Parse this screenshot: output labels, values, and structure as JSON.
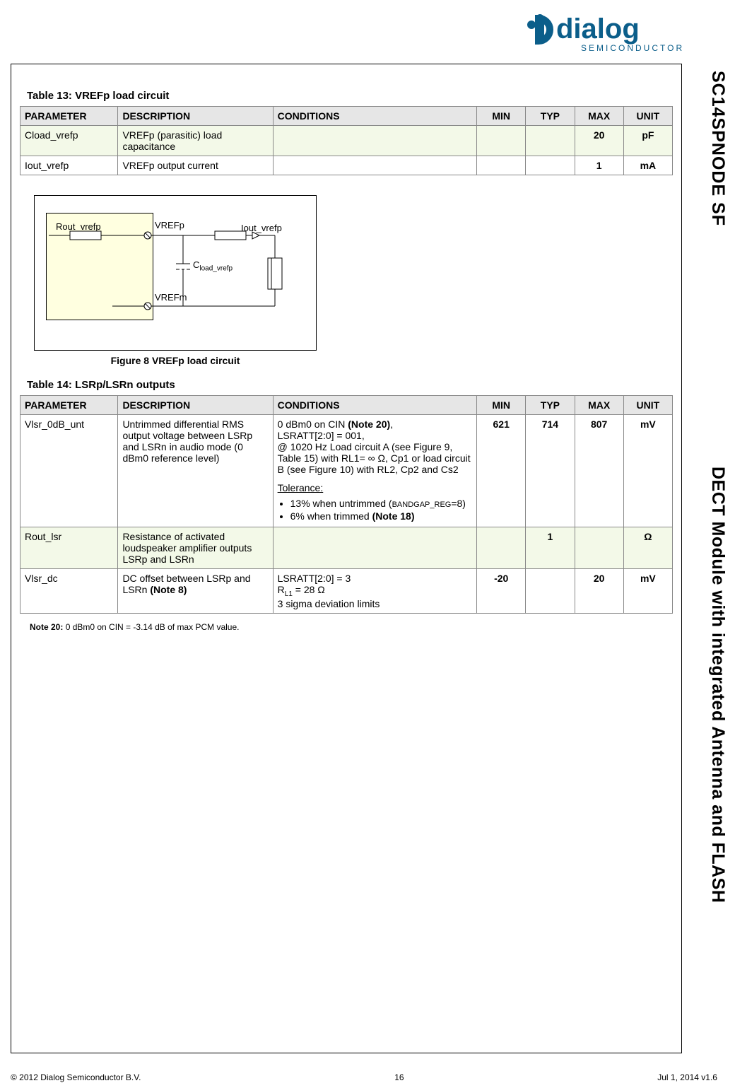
{
  "header": {
    "logo_main": "dialog",
    "logo_sub": "SEMICONDUCTOR"
  },
  "side": {
    "top": "SC14SPNODE SF",
    "bottom": "DECT Module with integrated Antenna and FLASH"
  },
  "table13": {
    "title": "Table 13: VREFp load circuit",
    "headers": [
      "PARAMETER",
      "DESCRIPTION",
      "CONDITIONS",
      "MIN",
      "TYP",
      "MAX",
      "UNIT"
    ],
    "rows": [
      {
        "param": "Cload_vrefp",
        "desc": "VREFp (parasitic) load capacitance",
        "cond": "",
        "min": "",
        "typ": "",
        "max": "20",
        "unit": "pF"
      },
      {
        "param": "Iout_vrefp",
        "desc": "VREFp output current",
        "cond": "",
        "min": "",
        "typ": "",
        "max": "1",
        "unit": "mA"
      }
    ]
  },
  "figure8": {
    "label_rout": "Rout_vrefp",
    "label_vrefp": "VREFp",
    "label_iout": "Iout_vrefp",
    "label_cload_prefix": "C",
    "label_cload_sub": "load_vrefp",
    "label_vrefm": "VREFm",
    "caption": "Figure 8  VREFp load circuit"
  },
  "table14": {
    "title": "Table 14: LSRp/LSRn outputs",
    "headers": [
      "PARAMETER",
      "DESCRIPTION",
      "CONDITIONS",
      "MIN",
      "TYP",
      "MAX",
      "UNIT"
    ],
    "rows": [
      {
        "param": "Vlsr_0dB_unt",
        "desc": "Untrimmed differential RMS output voltage between LSRp and LSRn in audio mode (0 dBm0 reference level)",
        "cond_line1_a": "0 dBm0 on CIN ",
        "cond_line1_b": "(Note 20)",
        "cond_line1_c": ",",
        "cond_line2": "LSRATT[2:0] = 001,",
        "cond_line3": "@ 1020 Hz Load circuit A (see Figure 9, Table 15) with RL1= ∞ Ω, Cp1 or load circuit B (see Figure 10) with RL2, Cp2 and Cs2",
        "tol_head": "Tolerance:",
        "tol1_a": "13% when untrimmed (",
        "tol1_b": "BANDGAP_REG",
        "tol1_c": "=8)",
        "tol2_a": "6% when trimmed ",
        "tol2_b": "(Note 18)",
        "min": "621",
        "typ": "714",
        "max": "807",
        "unit": "mV"
      },
      {
        "param": "Rout_lsr",
        "desc": "Resistance of activated loudspeaker amplifier outputs LSRp and LSRn",
        "cond": "",
        "min": "",
        "typ": "1",
        "max": "",
        "unit": "Ω"
      },
      {
        "param": "Vlsr_dc",
        "desc_a": "DC offset between LSRp and LSRn ",
        "desc_b": "(Note 8)",
        "cond_line1": "LSRATT[2:0] = 3",
        "cond_line2_a": "R",
        "cond_line2_sub": "L1",
        "cond_line2_b": " = 28 Ω",
        "cond_line3": "3 sigma deviation limits",
        "min": "-20",
        "typ": "",
        "max": "20",
        "unit": "mV"
      }
    ]
  },
  "note20": {
    "label": "Note 20:",
    "text": "0 dBm0 on CIN = -3.14 dB of max PCM value."
  },
  "footer": {
    "left": "© 2012 Dialog Semiconductor B.V.",
    "center": "16",
    "right": "Jul 1, 2014 v1.6"
  }
}
